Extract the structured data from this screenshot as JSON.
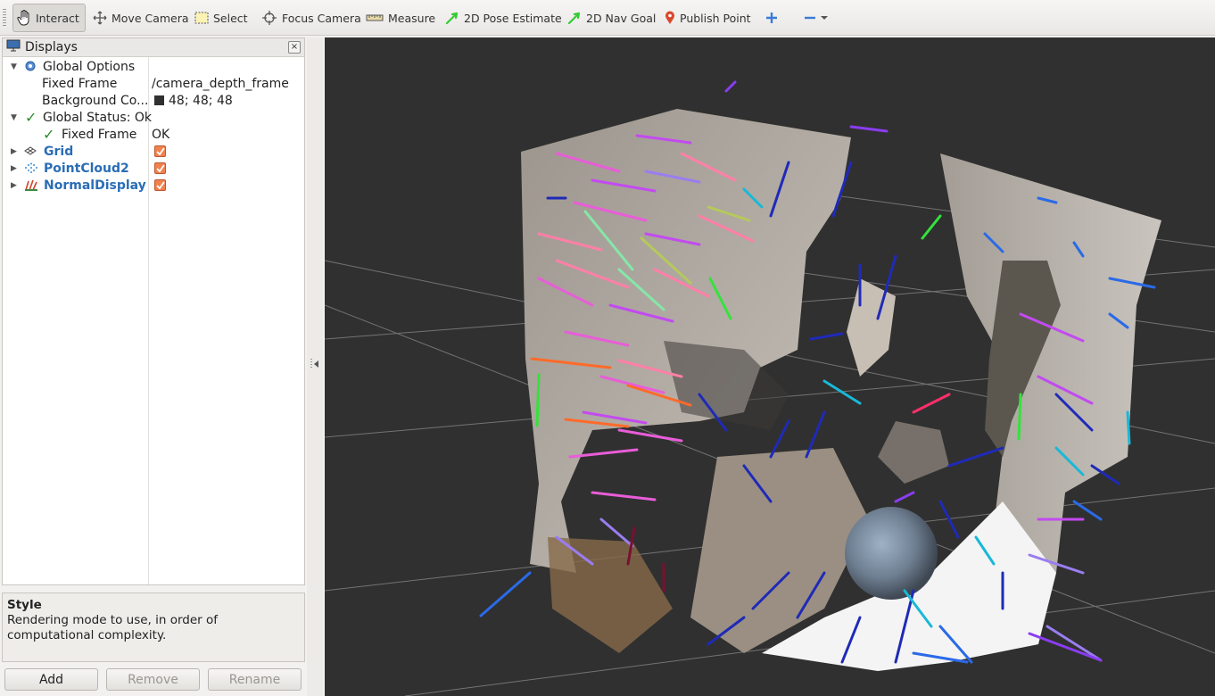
{
  "toolbar": {
    "tools": [
      {
        "label": "Interact",
        "icon": "hand-icon"
      },
      {
        "label": "Move Camera",
        "icon": "move-camera-icon"
      },
      {
        "label": "Select",
        "icon": "select-icon"
      },
      {
        "label": "Focus Camera",
        "icon": "focus-camera-icon"
      },
      {
        "label": "Measure",
        "icon": "measure-icon"
      },
      {
        "label": "2D Pose Estimate",
        "icon": "pose-arrow-icon"
      },
      {
        "label": "2D Nav Goal",
        "icon": "nav-goal-arrow-icon"
      },
      {
        "label": "Publish Point",
        "icon": "map-pin-icon"
      }
    ]
  },
  "displays": {
    "title": "Displays",
    "global_options": "Global Options",
    "fixed_frame_label": "Fixed Frame",
    "fixed_frame_value": "/camera_depth_frame",
    "background_label": "Background Co...",
    "background_value": "48; 48; 48",
    "global_status": "Global Status: Ok",
    "status_fixed_frame_label": "Fixed Frame",
    "status_fixed_frame_value": "OK",
    "grid": "Grid",
    "pointcloud": "PointCloud2",
    "normals": "NormalDisplay"
  },
  "help": {
    "title": "Style",
    "text": "Rendering mode to use, in order of computational complexity."
  },
  "buttons": {
    "add": "Add",
    "remove": "Remove",
    "rename": "Rename"
  },
  "colors": {
    "background": "#303030",
    "accent_blue": "#2a6db5",
    "checkbox": "#f0824e"
  }
}
